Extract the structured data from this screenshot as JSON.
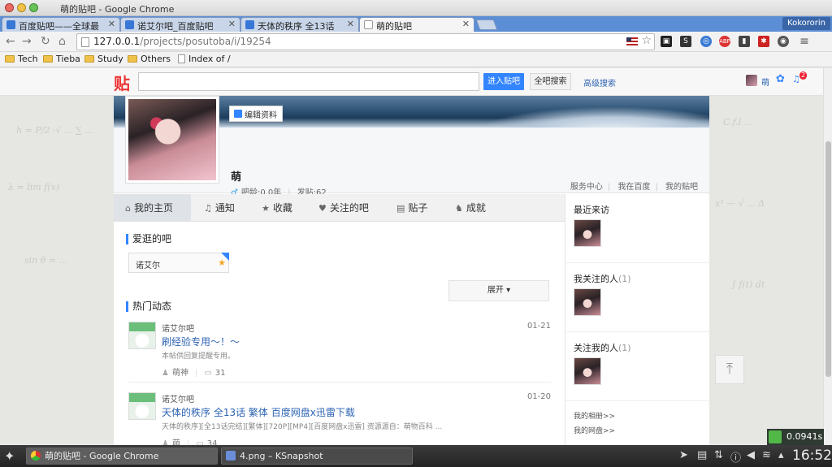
{
  "window": {
    "title": "萌的贴吧 - Google Chrome"
  },
  "tabs": [
    {
      "label": "百度贴吧——全球最",
      "active": false
    },
    {
      "label": "诺艾尔吧_百度贴吧",
      "active": false
    },
    {
      "label": "天体的秩序 全13话",
      "active": false
    },
    {
      "label": "萌的贴吧",
      "active": true
    }
  ],
  "profile_badge": "Kokororin",
  "address": {
    "host": "127.0.0.1",
    "path": "/projects/posutoba/i/19254"
  },
  "bookmarks": [
    {
      "label": "Tech",
      "type": "folder"
    },
    {
      "label": "Tieba",
      "type": "folder"
    },
    {
      "label": "Study",
      "type": "folder"
    },
    {
      "label": "Others",
      "type": "folder"
    },
    {
      "label": "Index of /",
      "type": "page"
    }
  ],
  "tieba_header": {
    "logo": "贴",
    "search_placeholder": "",
    "enter_bar": "进入贴吧",
    "search_all": "全吧搜索",
    "advanced": "高级搜索",
    "user": "萌",
    "notify_count": "2"
  },
  "profile": {
    "edit": "编辑资料",
    "name": "萌",
    "age": "吧龄:0.0年",
    "posts": "发贴:62",
    "links": [
      "服务中心",
      "我在百度",
      "我的贴吧"
    ]
  },
  "main_tabs": [
    {
      "label": "我的主页",
      "icon": "home-icon",
      "glyph": "⌂"
    },
    {
      "label": "通知",
      "icon": "bell-icon",
      "glyph": "♫"
    },
    {
      "label": "收藏",
      "icon": "star-icon",
      "glyph": "★"
    },
    {
      "label": "关注的吧",
      "icon": "heart-icon",
      "glyph": "♥"
    },
    {
      "label": "贴子",
      "icon": "document-icon",
      "glyph": "▤"
    },
    {
      "label": "成就",
      "icon": "person-icon",
      "glyph": "♞"
    }
  ],
  "favorites": {
    "title": "爱逛的吧",
    "bars": [
      "诺艾尔"
    ],
    "expand": "展开"
  },
  "feed": {
    "title": "热门动态",
    "items": [
      {
        "bar": "诺艾尔吧",
        "date": "01-21",
        "title": "刷经验专用～！～",
        "summary": "本帖供回复提醒专用。",
        "author": "萌神",
        "replies": "31"
      },
      {
        "bar": "诺艾尔吧",
        "date": "01-20",
        "title": "天体的秩序 全13话 繁体 百度网盘x迅雷下载",
        "summary": "天体的秩序][全13话完结][繁体][720P][MP4][百度网盘x迅雷] 资源源自：萌物百科 ...",
        "author": "萌",
        "replies": "34"
      }
    ]
  },
  "sidebar": {
    "recent_visitors": "最近来访",
    "following": "我关注的人",
    "following_count": "(1)",
    "followers": "关注我的人",
    "followers_count": "(1)",
    "album": "我的相册>>",
    "disk": "我的网盘>>"
  },
  "speed": "0.0941s",
  "taskbar": {
    "tasks": [
      {
        "label": "萌的贴吧 - Google Chrome",
        "active": true
      },
      {
        "label": "4.png – KSnapshot",
        "active": false
      }
    ],
    "clock": "16:52"
  },
  "colors": {
    "tieba_blue": "#3385ff",
    "link_blue": "#2d64b3",
    "tab_strip": "#5c8ed6",
    "logo_red": "#ee3333"
  }
}
